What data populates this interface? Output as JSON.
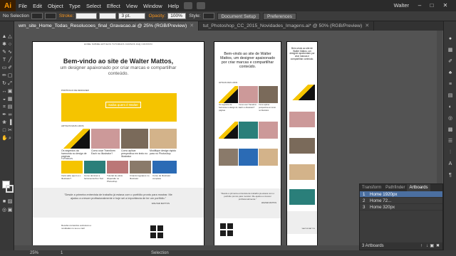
{
  "menubar": {
    "logo": "Ai",
    "items": [
      "File",
      "Edit",
      "Object",
      "Type",
      "Select",
      "Effect",
      "View",
      "Window",
      "Help"
    ],
    "user": "Walter",
    "window_controls": [
      "–",
      "□",
      "✕"
    ]
  },
  "control_bar": {
    "selection_label": "No Selection",
    "stroke_label": "Stroke:",
    "stroke_profile": "3 pt. Round",
    "opacity_label": "Opacity:",
    "opacity_value": "100%",
    "style_label": "Style:",
    "document_setup": "Document Setup",
    "preferences": "Preferences"
  },
  "tabs": [
    {
      "label": "wm_site_Home_Todas_Resolucoes_final_Gravacao.ai @ 25% (RGB/Preview)",
      "active": true
    },
    {
      "label": "tut_Photoshop_CC_2015_Novidades_Imagens.ai* @ 50% (RGB/Preview)",
      "active": false
    }
  ],
  "artboard_desktop": {
    "nav": "HOME   SOBRE   ARTIGOS   TUTORIAIS   CURSOS   FAQ   CONTATO",
    "title": "Bem-vindo ao site de Walter Mattos,",
    "subtitle": "um designer apaixonado por criar marcas e compartilhar conteúdo.",
    "banner_label": "Saiba quem é Walter",
    "banner_caption": "PORTFOLIO DE DESIGNER",
    "section1": "ARTIGOS MAIS LIDOS",
    "cards": [
      "Os segredos da harmonia no design de páginas",
      "Como usar Transform Each no Illustrator?",
      "Como aplicar perspectiva em texto no Illustrator",
      "Modifique design rápido para no Photoshop"
    ],
    "section2": "TUTORIAIS",
    "tutorials": [
      "Você sabe quem é o Illustrator?",
      "Como dominar a ferramenta Pen Tool",
      "Tutorial de efeito dispersão no Photoshop",
      "Criando logotipos no Illustrator",
      "Curso de Illustrator completo"
    ],
    "quote": "\"Desde a primeira entrevista de trabalho já estava com o portfólio pronto para mostrar. Me ajudou a crescer profissionalmente e hoje sei a importância de ter um portfólio.\"",
    "quote_author": "WALTER MATTOS",
    "newsletter": "Receba conteúdos exclusivos e novidades no seu e-mail"
  },
  "artboard_tablet": {
    "title": "Bem-vindo ao site de Walter Mattos, um designer apaixonado por criar marcas e compartilhar conteúdo.",
    "section1": "ARTIGOS MAIS LIDOS",
    "cards": [
      "Os segredos da harmonia no design de páginas",
      "Como usar Transform Each no Illustrator?",
      "Como aplicar perspectiva em texto no Illustrator"
    ],
    "quote": "\"Desde a primeira entrevista de trabalho já estava com o portfólio pronto para mostrar. Me ajudou a crescer profissionalmente.\"",
    "quote_author": "WALTER MATTOS"
  },
  "artboard_mobile": {
    "title": "Bem-vindo ao site de Walter Mattos, um designer apaixonado por criar marcas e compartilhar conteúdo.",
    "quote_author": "WALTER MATTOS"
  },
  "artboards_panel": {
    "tabs": [
      "Transform",
      "Pathfinder",
      "Artboards"
    ],
    "rows": [
      {
        "num": "1",
        "name": "Home 1920px",
        "selected": true
      },
      {
        "num": "2",
        "name": "Home 72...",
        "selected": false
      },
      {
        "num": "3",
        "name": "Home 320px",
        "selected": false
      }
    ],
    "count": "3 Artboards"
  },
  "status_bar": {
    "zoom": "25%",
    "page": "1",
    "tool": "Selection"
  },
  "colors": {
    "accent_yellow": "#f5c400",
    "illustrator_orange": "#ff9a00",
    "panel_selected": "#4b6fa0"
  }
}
